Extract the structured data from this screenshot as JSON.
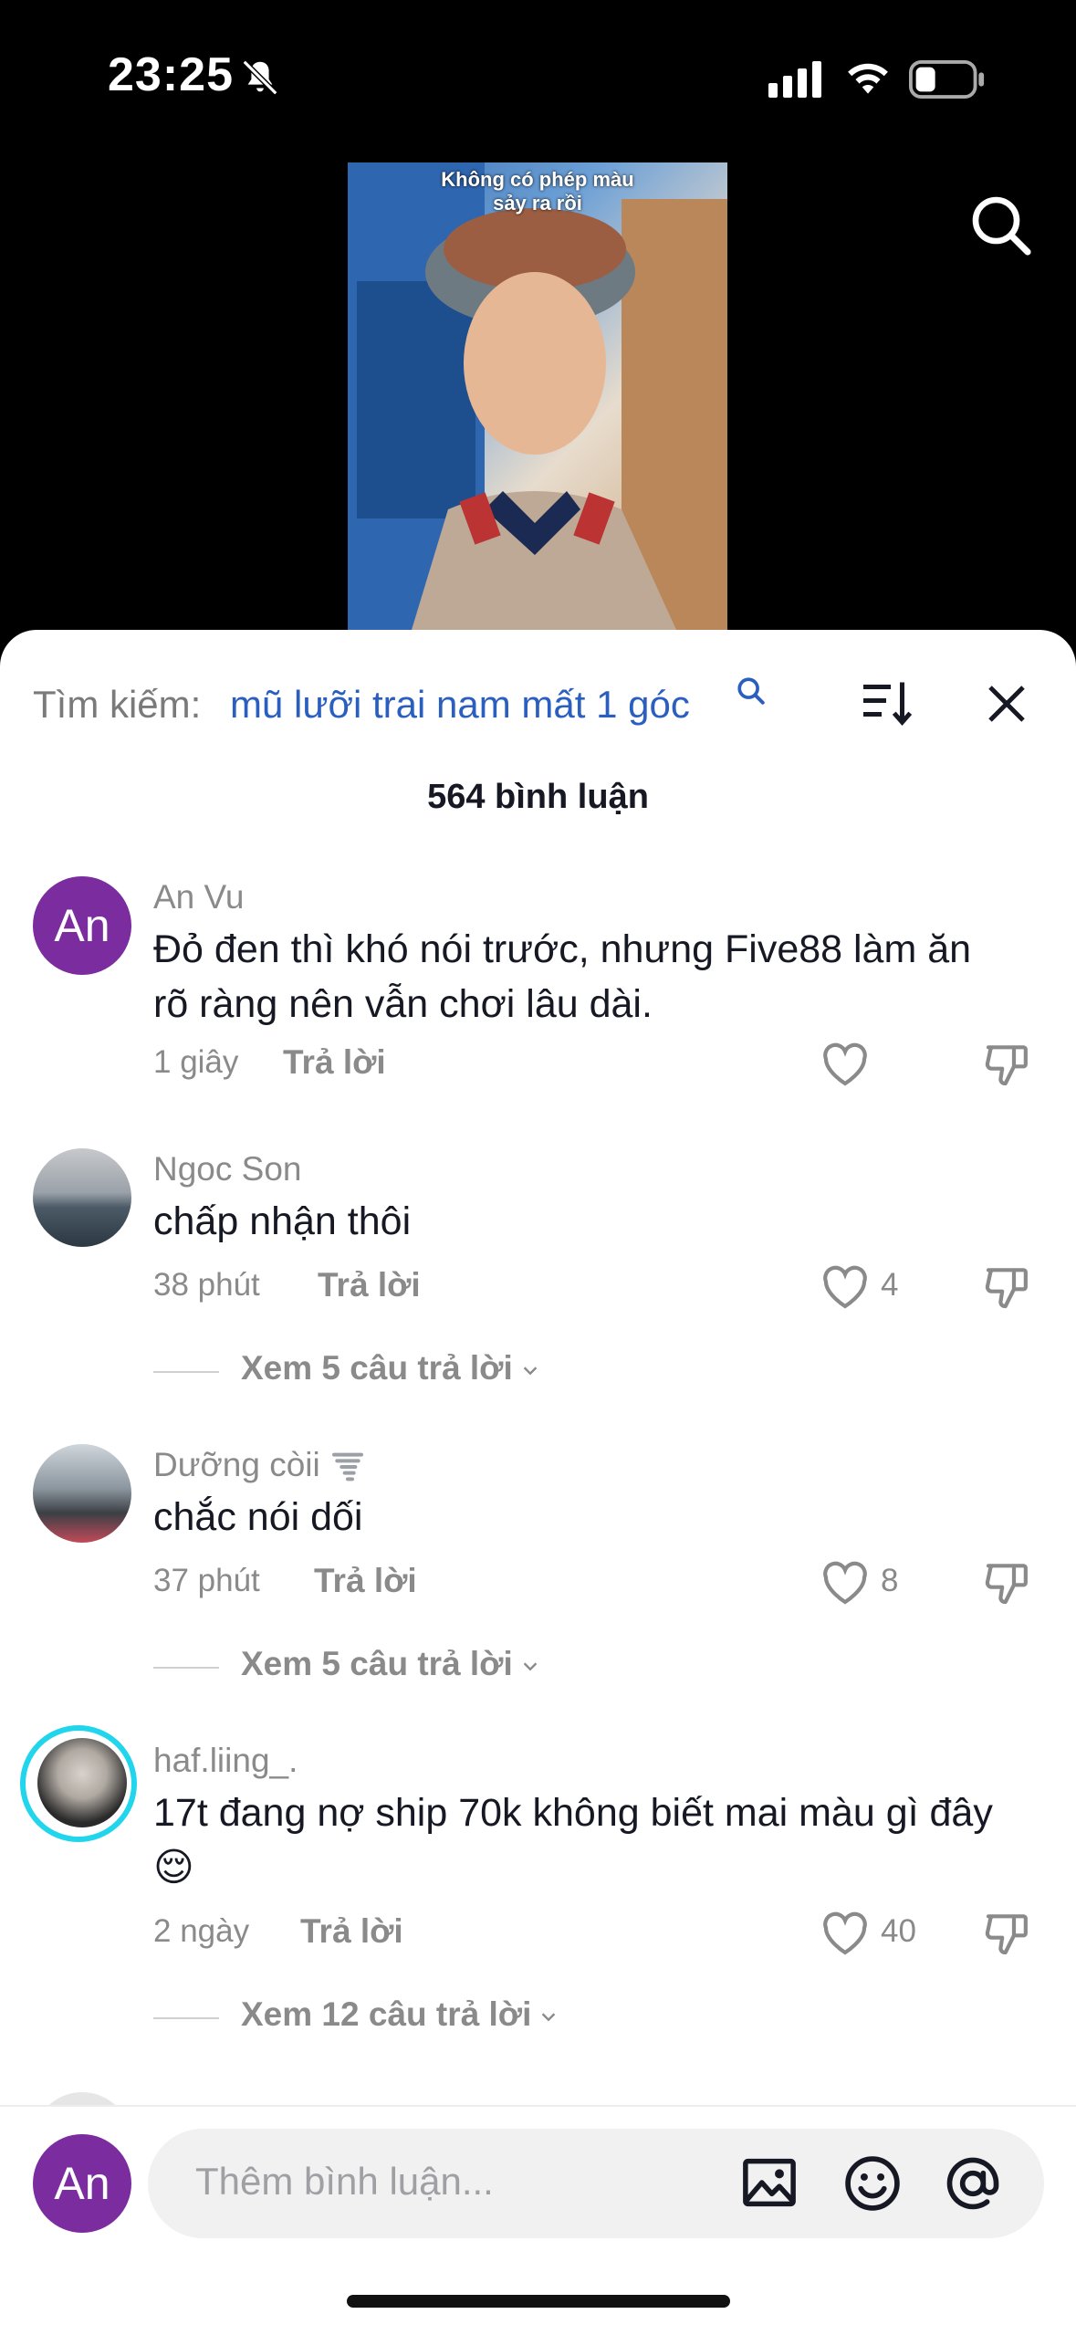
{
  "status_bar": {
    "time": "23:25"
  },
  "video": {
    "caption_line1": "Không có phép màu",
    "caption_line2": "sảy ra rồi"
  },
  "search": {
    "label": "Tìm kiếm:",
    "query": "mũ lưỡi trai nam mất 1 góc"
  },
  "comment_count": "564 bình luận",
  "comments": [
    {
      "avatar_letter": "An",
      "username": "An Vu",
      "text": "Đỏ đen thì khó nói trước, nhưng Five88 làm ăn rõ ràng nên vẫn chơi lâu dài.",
      "time": "1 giây",
      "reply": "Trả lời",
      "likes": ""
    },
    {
      "username": "Ngoc Son",
      "text": "chấp nhận thôi",
      "time": "38 phút",
      "reply": "Trả lời",
      "likes": "4",
      "view_replies": "Xem 5 câu trả lời"
    },
    {
      "username": "Dưỡng còii",
      "text": "chắc nói dối",
      "time": "37 phút",
      "reply": "Trả lời",
      "likes": "8",
      "view_replies": "Xem 5 câu trả lời"
    },
    {
      "username": "haf.liing_.",
      "text": "17t đang nợ ship 70k không biết mai màu gì đây 😌",
      "time": "2 ngày",
      "reply": "Trả lời",
      "likes": "40",
      "view_replies": "Xem 12 câu trả lời"
    }
  ],
  "input": {
    "avatar_letter": "An",
    "placeholder": "Thêm bình luận..."
  },
  "colors": {
    "accent_blue": "#2b5fbf",
    "avatar_purple": "#7b2da0",
    "story_ring": "#20d5ec"
  }
}
